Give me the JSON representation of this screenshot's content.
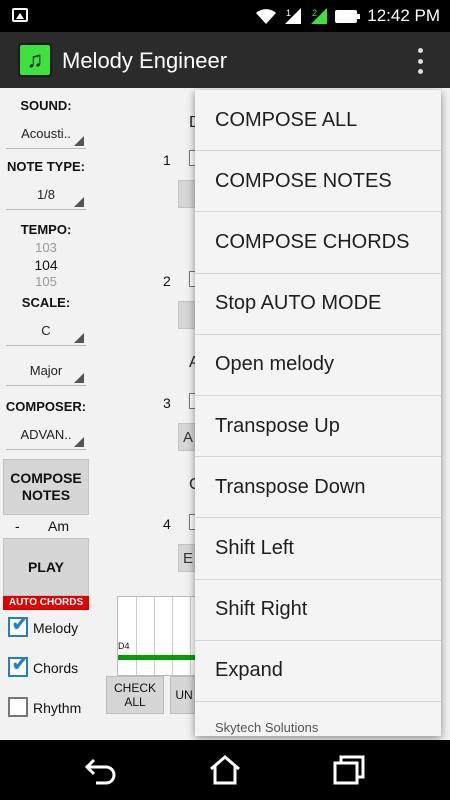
{
  "status_bar": {
    "time": "12:42 PM",
    "sim1": "1",
    "sim2": "2"
  },
  "app_bar": {
    "title": "Melody Engineer"
  },
  "left_panel": {
    "sound_label": "SOUND:",
    "sound_value": "Acousti..",
    "note_type_label": "NOTE TYPE:",
    "note_type_value": "1/8",
    "tempo_label": "TEMPO:",
    "tempo_prev": "103",
    "tempo_value": "104",
    "tempo_next": "105",
    "scale_label": "SCALE:",
    "scale_key": "C",
    "scale_mode": "Major",
    "composer_label": "COMPOSER:",
    "composer_value": "ADVAN..",
    "compose_notes_button": "COMPOSE NOTES",
    "chord_dash": "-",
    "chord_name": "Am",
    "play_button": "PLAY",
    "auto_chords": "AUTO CHORDS",
    "checkboxes": [
      {
        "label": "Melody",
        "checked": true
      },
      {
        "label": "Chords",
        "checked": true
      },
      {
        "label": "Rhythm",
        "checked": false
      }
    ]
  },
  "background": {
    "rows": [
      "1",
      "2",
      "3",
      "4"
    ],
    "col_d": "D",
    "row_a": "A",
    "row_a_cell": "A",
    "row_c": "C",
    "row_e_cell": "E",
    "graph_label": "D4",
    "check_all_button": "CHECK ALL",
    "second_button": "UN",
    "footer_text": "Skytech Solutions"
  },
  "menu": {
    "items": [
      "COMPOSE ALL",
      "COMPOSE NOTES",
      "COMPOSE CHORDS",
      "Stop AUTO MODE",
      "Open melody",
      "Transpose Up",
      "Transpose Down",
      "Shift Left",
      "Shift Right",
      "Expand",
      "Skytech Solutions"
    ]
  },
  "icons": [
    "image-icon",
    "wifi-icon",
    "signal-icon",
    "battery-icon",
    "music-note-icon",
    "overflow-menu-icon",
    "back-icon",
    "home-icon",
    "recents-icon"
  ],
  "colors": {
    "accent_green": "#3fe13f",
    "auto_chords_red": "#e00000",
    "checkbox_blue": "#2a7fb8",
    "graph_green": "#0b9a0b"
  }
}
